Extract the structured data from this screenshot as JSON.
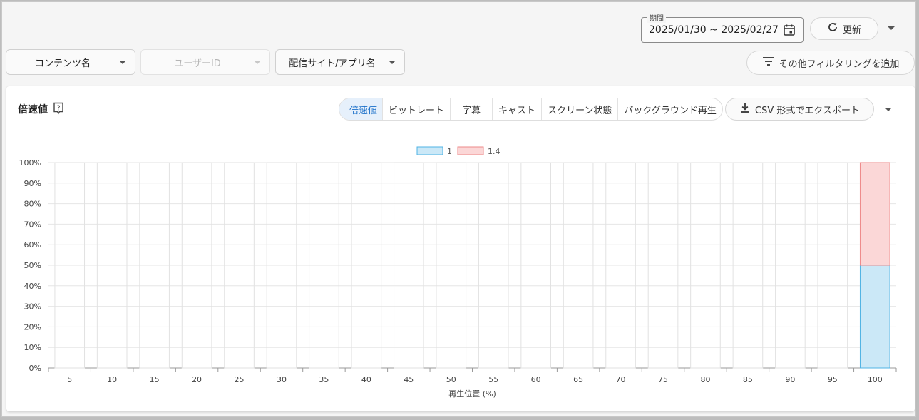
{
  "header": {
    "period_label": "期間",
    "period_value": "2025/01/30 ~ 2025/02/27",
    "refresh_label": "更新"
  },
  "filters": [
    {
      "label": "コンテンツ名",
      "disabled": false
    },
    {
      "label": "ユーザーID",
      "disabled": true
    },
    {
      "label": "配信サイト/アプリ名",
      "disabled": false
    }
  ],
  "more_filter_label": "その他フィルタリングを追加",
  "card": {
    "title": "倍速値",
    "tabs": [
      "倍速値",
      "ビットレート",
      "字幕",
      "キャスト",
      "スクリーン状態",
      "バックグラウンド再生"
    ],
    "active_tab": 0,
    "export_label": "CSV 形式でエクスポート"
  },
  "chart_data": {
    "type": "bar",
    "stacked": true,
    "categories": [
      "5",
      "10",
      "15",
      "20",
      "25",
      "30",
      "35",
      "40",
      "45",
      "50",
      "55",
      "60",
      "65",
      "70",
      "75",
      "80",
      "85",
      "90",
      "95",
      "100"
    ],
    "series": [
      {
        "name": "1",
        "color": "#cbe8f7",
        "border": "#4fb3e4",
        "values": [
          0,
          0,
          0,
          0,
          0,
          0,
          0,
          0,
          0,
          0,
          0,
          0,
          0,
          0,
          0,
          0,
          0,
          0,
          0,
          50
        ]
      },
      {
        "name": "1.4",
        "color": "#fbd7d7",
        "border": "#ee8a8a",
        "values": [
          0,
          0,
          0,
          0,
          0,
          0,
          0,
          0,
          0,
          0,
          0,
          0,
          0,
          0,
          0,
          0,
          0,
          0,
          0,
          50
        ]
      }
    ],
    "ylim": [
      0,
      100
    ],
    "yticks": [
      "0%",
      "10%",
      "20%",
      "30%",
      "40%",
      "50%",
      "60%",
      "70%",
      "80%",
      "90%",
      "100%"
    ],
    "xlabel": "再生位置 (%)",
    "legend": "top-center",
    "grid": true
  }
}
